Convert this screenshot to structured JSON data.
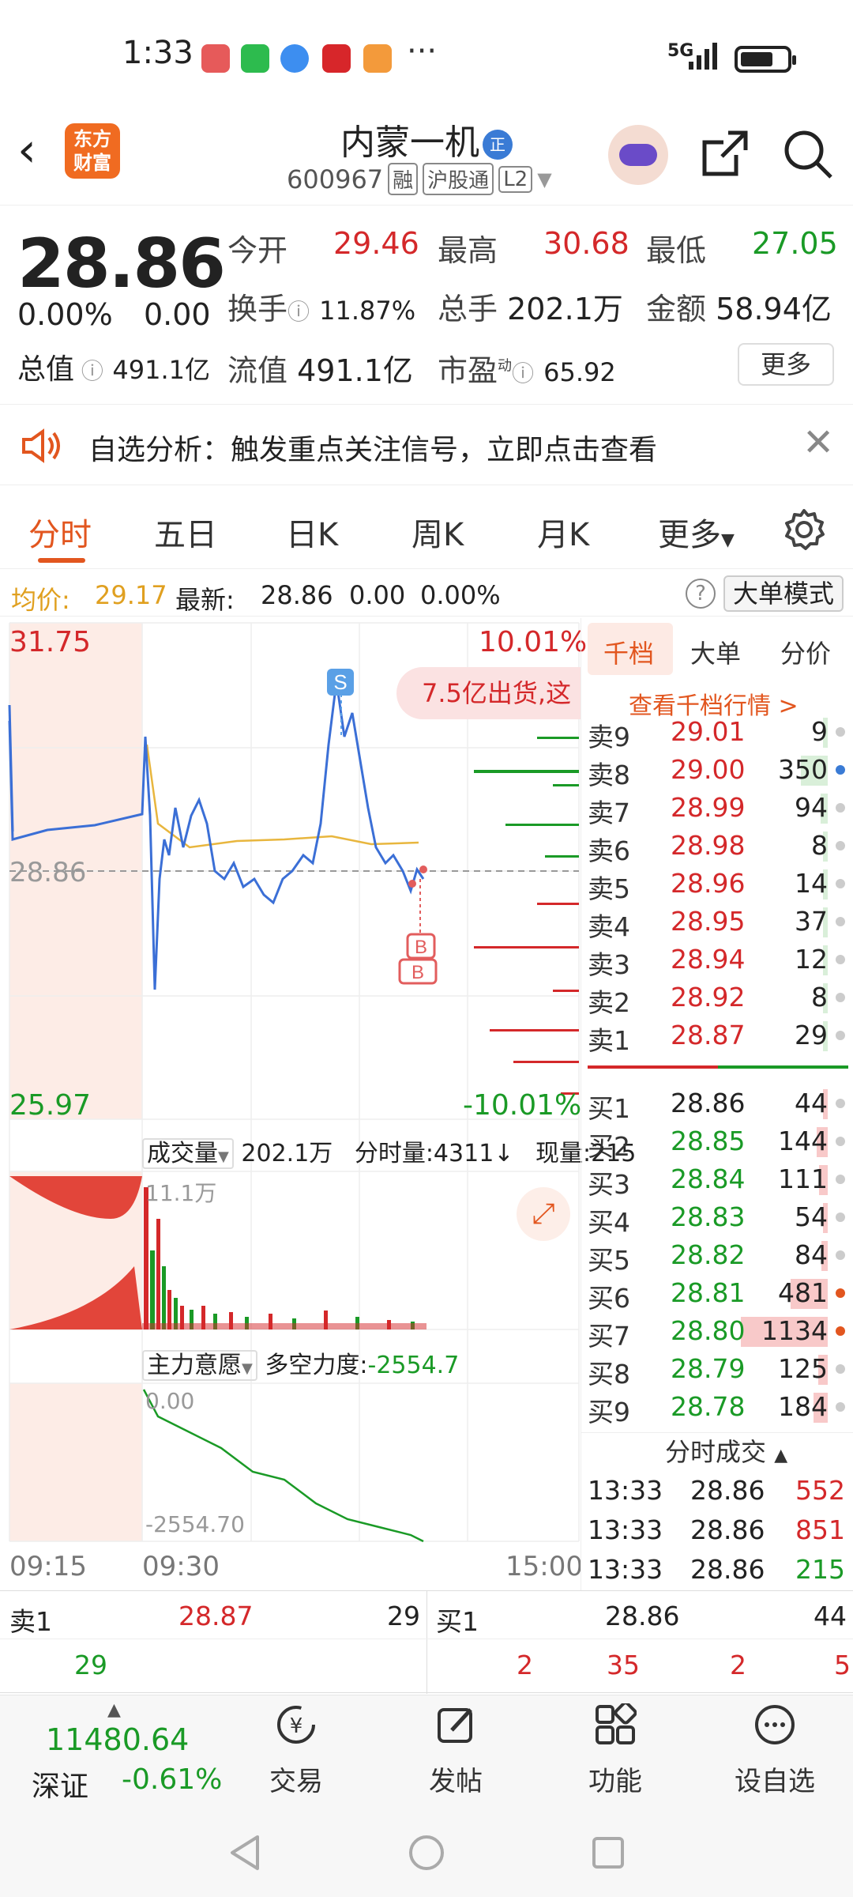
{
  "status_bar": {
    "time": "1:33",
    "signal": "5G"
  },
  "header": {
    "title": "内蒙一机",
    "badge": "正",
    "code": "600967",
    "tag1": "融",
    "tag2": "沪股通",
    "tag3": "L2",
    "logo_text1": "东方",
    "logo_text2": "财富"
  },
  "quote": {
    "price": "28.86",
    "change_pct": "0.00%",
    "change": "0.00",
    "open_label": "今开",
    "open": "29.46",
    "high_label": "最高",
    "high": "30.68",
    "low_label": "最低",
    "low": "27.05",
    "turnover_label": "换手",
    "turnover": "11.87%",
    "volume_label": "总手",
    "volume": "202.1万",
    "amount_label": "金额",
    "amount": "58.94亿",
    "mktcap_label": "总值",
    "mktcap": "491.1亿",
    "float_label": "流值",
    "float": "491.1亿",
    "pe_label": "市盈",
    "pe_sup": "动",
    "pe": "65.92",
    "more": "更多"
  },
  "notice": {
    "text": "自选分析：触发重点关注信号，立即点击查看"
  },
  "tabs": [
    "分时",
    "五日",
    "日K",
    "周K",
    "月K",
    "更多"
  ],
  "avgbar": {
    "avg_label": "均价:",
    "avg": "29.17",
    "last_label": "最新:",
    "last": "28.86",
    "chg": "0.00",
    "pct": "0.00%",
    "mode": "大单模式"
  },
  "chart": {
    "ymax": "31.75",
    "ymin": "25.97",
    "mid": "28.86",
    "pct_max": "10.01%",
    "pct_min": "-10.01%",
    "bubble": "7.5亿出货,这",
    "s_marker": "S",
    "b_marker": "B",
    "vol_label": "成交量",
    "vol_total": "202.1万",
    "vol_min_label": "分时量:4311↓",
    "vol_now": "现量:215",
    "vol_max": "11.1万",
    "main_label": "主力意愿",
    "main_force": "多空力度:",
    "main_value": "-2554.7",
    "main_top": "0.00",
    "main_bottom": "-2554.70",
    "t1": "09:15",
    "t2": "09:30",
    "t3": "15:00"
  },
  "book": {
    "tabs": [
      "千档",
      "大单",
      "分价"
    ],
    "link": "查看千档行情 >",
    "asks": [
      {
        "label": "卖9",
        "price": "29.01",
        "vol": "9"
      },
      {
        "label": "卖8",
        "price": "29.00",
        "vol": "350"
      },
      {
        "label": "卖7",
        "price": "28.99",
        "vol": "94"
      },
      {
        "label": "卖6",
        "price": "28.98",
        "vol": "8"
      },
      {
        "label": "卖5",
        "price": "28.96",
        "vol": "14"
      },
      {
        "label": "卖4",
        "price": "28.95",
        "vol": "37"
      },
      {
        "label": "卖3",
        "price": "28.94",
        "vol": "12"
      },
      {
        "label": "卖2",
        "price": "28.92",
        "vol": "8"
      },
      {
        "label": "卖1",
        "price": "28.87",
        "vol": "29"
      }
    ],
    "bids": [
      {
        "label": "买1",
        "price": "28.86",
        "vol": "44"
      },
      {
        "label": "买2",
        "price": "28.85",
        "vol": "144"
      },
      {
        "label": "买3",
        "price": "28.84",
        "vol": "111"
      },
      {
        "label": "买4",
        "price": "28.83",
        "vol": "54"
      },
      {
        "label": "买5",
        "price": "28.82",
        "vol": "84"
      },
      {
        "label": "买6",
        "price": "28.81",
        "vol": "481"
      },
      {
        "label": "买7",
        "price": "28.80",
        "vol": "1134"
      },
      {
        "label": "买8",
        "price": "28.79",
        "vol": "125"
      },
      {
        "label": "买9",
        "price": "28.78",
        "vol": "184"
      }
    ],
    "ticks_title": "分时成交",
    "ticks": [
      {
        "time": "13:33",
        "price": "28.86",
        "vol": "552"
      },
      {
        "time": "13:33",
        "price": "28.86",
        "vol": "851"
      },
      {
        "time": "13:33",
        "price": "28.86",
        "vol": "215"
      }
    ]
  },
  "summary": {
    "ask_label": "卖1",
    "ask_price": "28.87",
    "ask_vol": "29",
    "bid_label": "买1",
    "bid_price": "28.86",
    "bid_vol": "44",
    "ask_queue": [
      "29"
    ],
    "bid_queue": [
      "2",
      "35",
      "2",
      "5"
    ]
  },
  "bottom_nav": {
    "index_value": "11480.64",
    "index_name": "深证",
    "index_change": "-0.61%",
    "items": [
      "交易",
      "发帖",
      "功能",
      "设自选"
    ]
  },
  "colors": {
    "up": "#d4282a",
    "down": "#1a9a26",
    "accent": "#e2561f"
  }
}
